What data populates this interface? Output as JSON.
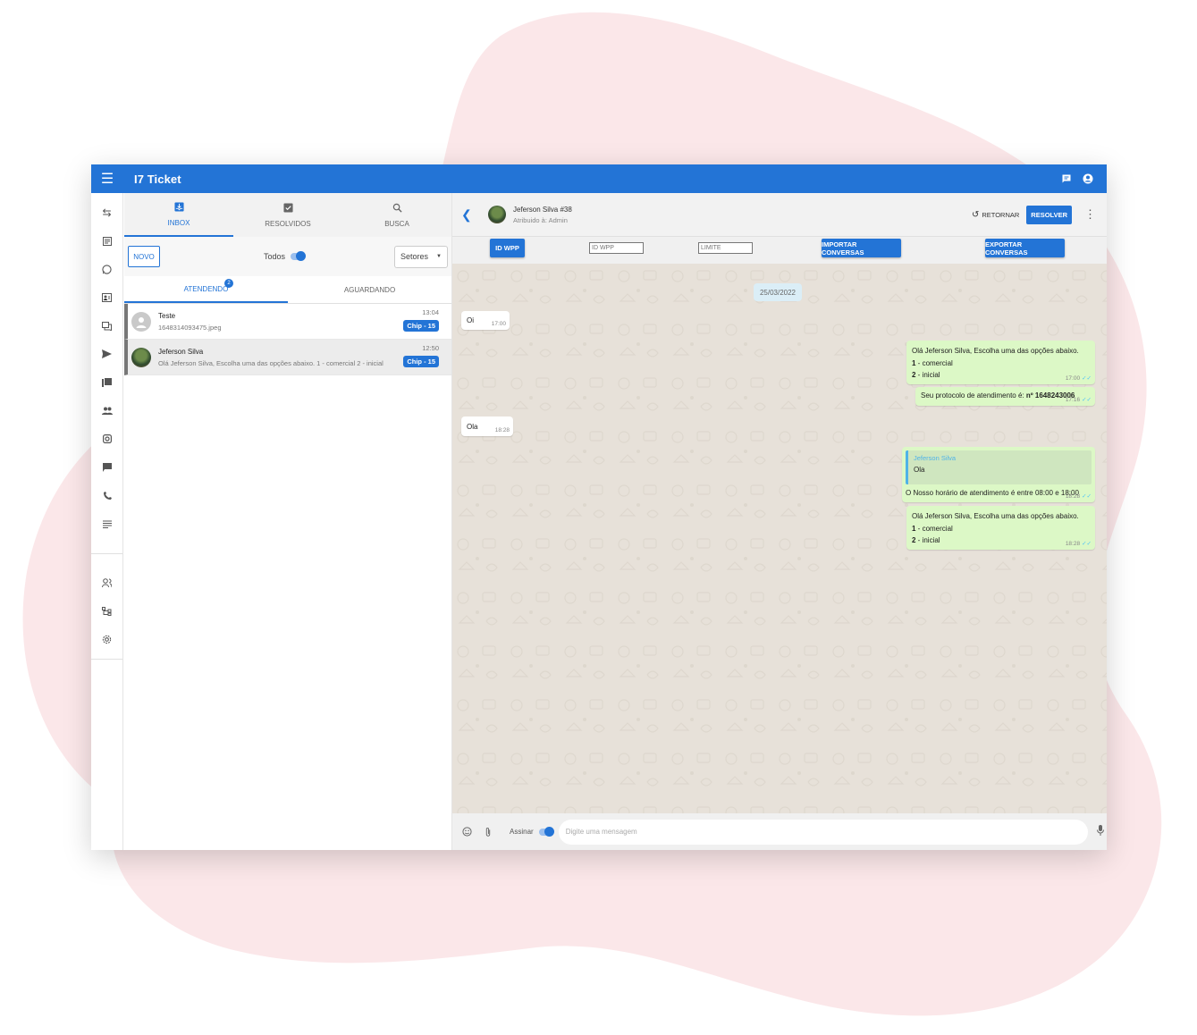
{
  "app": {
    "title": "I7 Ticket"
  },
  "tabs": [
    {
      "label": "INBOX",
      "icon": "inbox-icon"
    },
    {
      "label": "RESOLVIDOS",
      "icon": "check-box-icon"
    },
    {
      "label": "BUSCA",
      "icon": "search-icon"
    }
  ],
  "filters": {
    "novo": "NOVO",
    "todos": "Todos",
    "setores": "Setores"
  },
  "subtabs": {
    "atendendo": "ATENDENDO",
    "atendendo_count": "2",
    "aguardando": "AGUARDANDO"
  },
  "tickets": [
    {
      "name": "Teste",
      "message": "1648314093475.jpeg",
      "time": "13:04",
      "chip": "Chip - 15"
    },
    {
      "name": "Jeferson Silva",
      "message": "Olá Jeferson Silva, Escolha uma das opções abaixo. 1 - comercial 2 - inicial",
      "time": "12:50",
      "chip": "Chip - 15"
    }
  ],
  "chat": {
    "contact_name": "Jeferson Silva #38",
    "assigned": "Atribuido à: Admin",
    "retornar": "RETORNAR",
    "resolver": "RESOLVER"
  },
  "toolbar": {
    "id_wpp_button": "ID WPP",
    "id_wpp_placeholder": "ID WPP",
    "limite_placeholder": "LIMITE",
    "importar": "IMPORTAR CONVERSAS",
    "exportar": "EXPORTAR CONVERSAS"
  },
  "messages": {
    "date": "25/03/2022",
    "m1_text": "Oi",
    "m1_time": "17:00",
    "m2_l1": "Olá Jeferson Silva, Escolha uma das opções abaixo.",
    "m2_l2a": "1",
    "m2_l2b": " - comercial",
    "m2_l3a": "2",
    "m2_l3b": " - inicial",
    "m2_time": "17:00",
    "m3_text": "Seu protocolo de atendimento é: ",
    "m3_bold": "nº 1648243006",
    "m3_time": "17:16",
    "m4_text": "Ola",
    "m4_time": "18:28",
    "m5_quote_name": "Jeferson Silva",
    "m5_quote_text": "Ola",
    "m5_text": "O Nosso horário de atendimento é entre 08:00 e 18:00",
    "m5_time": "18:28",
    "m6_l1": "Olá Jeferson Silva, Escolha uma das opções abaixo.",
    "m6_l2a": "1",
    "m6_l2b": " - comercial",
    "m6_l3a": "2",
    "m6_l3b": " - inicial",
    "m6_time": "18:28"
  },
  "composer": {
    "assinar": "Assinar",
    "placeholder": "Digite uma mensagem"
  },
  "colors": {
    "primary": "#2374d6",
    "bubble_out": "#dcf8c6",
    "chat_bg": "#e7e1d9",
    "blob": "#fbe7e9"
  }
}
